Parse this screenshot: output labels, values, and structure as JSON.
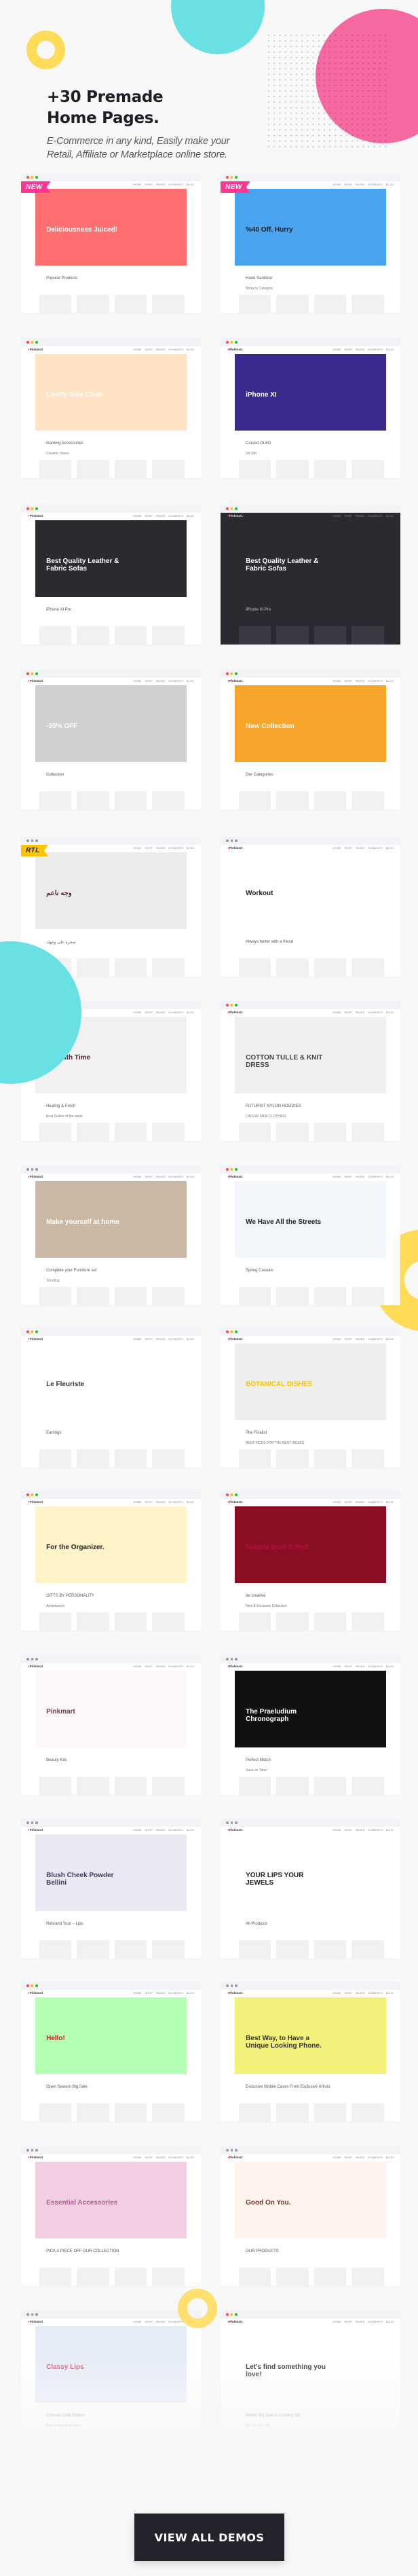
{
  "hero": {
    "title_line1": "+30 Premade",
    "title_line2": "Home Pages.",
    "subtitle_line1": "E-Commerce in any kind, Easily make your",
    "subtitle_line2": "Retail, Affiliate or Marketplace online store."
  },
  "colors": {
    "accent_pink": "#fd6ba5",
    "accent_cyan": "#69e0e4",
    "accent_yellow": "#ffdb58",
    "button_dark": "#22232b",
    "background": "#f8f8f9"
  },
  "demos": [
    {
      "ribbon": "NEW",
      "headline": "Deliciousness Juiced!",
      "sub": "Popular Products",
      "bg": "#ff6f6f",
      "fg": "#ffffff",
      "dots": "color"
    },
    {
      "ribbon": "NEW",
      "headline": "%40 Off. Hurry",
      "sub": "Hand Sanitizer",
      "extra": "Shop by Category",
      "bg": "#4aa3ef",
      "fg": "#1d1f27",
      "dots": "color"
    },
    {
      "headline": "Comfy Side Chair",
      "sub": "Gaming Accessories",
      "extra": "Ceramic Vases",
      "bg": "#ffe3c4",
      "fg": "#ffffff",
      "dots": "color"
    },
    {
      "headline": "iPhone XI",
      "sub": "Curved OLED",
      "extra": "VR Rift",
      "bg": "#3b2a8c",
      "fg": "#ffffff",
      "dots": "color"
    },
    {
      "headline": "Best Quality Leather & Fabric Sofas",
      "sub": "iPhone XI Pro",
      "bg": "#2a2b31",
      "fg": "#ffffff",
      "dots": "color"
    },
    {
      "headline": "Best Quality Leather & Fabric Sofas",
      "sub": "iPhone XI Pro",
      "bg": "#2a2b31",
      "fg": "#ffffff",
      "dots": "color",
      "dark": true
    },
    {
      "headline": "-35% OFF",
      "sub": "Collection",
      "bg": "#cfcfcf",
      "fg": "#ffffff",
      "dots": "color"
    },
    {
      "headline": "New Collection",
      "sub": "Our Categories",
      "bg": "#f7a52b",
      "fg": "#ffffff",
      "dots": "color"
    },
    {
      "ribbon": "RTL",
      "headline": "وجه ناعم",
      "sub": "صخرة على وجهك",
      "bg": "#ebebeb",
      "fg": "#5a1f2a",
      "dots": "grey"
    },
    {
      "headline": "Workout",
      "sub": "Always better with a friend",
      "bg": "#ffffff",
      "fg": "#1d1f27",
      "dots": "grey"
    },
    {
      "headline": "It's Bath Time",
      "sub": "Healing & Fresh",
      "extra": "Best Sellers of the week",
      "bg": "#f2f0f1",
      "fg": "#5a1f2a",
      "dots": "grey"
    },
    {
      "headline": "COTTON TULLE & KNIT DRESS",
      "sub": "FUTURIST NYLON HOODIES",
      "extra": "CASUAL MEN CLOTHING",
      "bg": "#efefef",
      "fg": "#444444",
      "dots": "color"
    },
    {
      "headline": "Make yourself at home",
      "sub": "Complete your Furniture set",
      "extra": "Trending",
      "bg": "#c9b8a6",
      "fg": "#ffffff",
      "dots": "grey"
    },
    {
      "headline": "We Have All the Streets",
      "sub": "Spring Casuals",
      "bg": "#f3f6fb",
      "fg": "#1d1f27",
      "dots": "none"
    },
    {
      "headline": "Le Fleuriste",
      "sub": "Earrings",
      "bg": "#ffffff",
      "fg": "#333333",
      "dots": "color"
    },
    {
      "headline": "BOTANICAL DISHES",
      "sub": "The Finalist",
      "extra": "BEST PICKS FOR THE BEST WEEKS",
      "bg": "#eeeeee",
      "fg": "#f5c400",
      "dots": "color"
    },
    {
      "headline": "For the Organizer.",
      "sub": "GIFTS BY PERSONALITY",
      "extra": "Adventurers",
      "bg": "#fff4c8",
      "fg": "#222222",
      "dots": "color"
    },
    {
      "headline": "Natural Born Gifted",
      "sub": "be creative",
      "extra": "New & Exclusive Collection",
      "bg": "#8a0f25",
      "fg": "#b0113a",
      "dots": "color"
    },
    {
      "headline": "Pinkmart",
      "sub": "Beauty Kits",
      "bg": "#fdf7f7",
      "fg": "#6b3d4a",
      "dots": "grey"
    },
    {
      "headline": "The Praeludium Chronograph",
      "sub": "Perfect Match",
      "extra": "Save on Time!",
      "bg": "#111111",
      "fg": "#ffffff",
      "dots": "grey"
    },
    {
      "headline": "Blush Cheek Powder Bellini",
      "sub": "Rebrand Your – Lips",
      "bg": "#ebe7f3",
      "fg": "#3d3a60",
      "dots": "grey"
    },
    {
      "headline": "YOUR LIPS YOUR JEWELS",
      "sub": "All Products",
      "bg": "#ffffff",
      "fg": "#1d1f27",
      "dots": "grey"
    },
    {
      "headline": "Hello!",
      "sub": "Open Season Big Sale",
      "bg": "#b5ffb5",
      "fg": "#d2121f",
      "dots": "color"
    },
    {
      "headline": "Best Way, to Have a Unique Looking Phone.",
      "sub": "Exclusive Mobile Cases From Exclusive Artists.",
      "bg": "#f2f27a",
      "fg": "#333333",
      "dots": "grey"
    },
    {
      "headline": "Essential Accessories",
      "sub": "PICK A PIECE OFF OUR COLLECTION",
      "bg": "#f3cfe3",
      "fg": "#b85a93",
      "dots": "grey"
    },
    {
      "headline": "Good On You.",
      "sub": "OUR PRODUCTS",
      "bg": "#fff3ee",
      "fg": "#7a3a2c",
      "dots": "grey"
    },
    {
      "headline": "Classy Lips",
      "sub": "Crimson Gold Edition",
      "extra": "Best Selling Right Now",
      "bg": "#e6ecf7",
      "fg": "#e85577",
      "dots": "grey"
    },
    {
      "headline": "Let's find something you love!",
      "sub": "Winter Big Sale is Coming Up!",
      "extra": "06 : 22 : 54 : 54",
      "bg": "#ffffff",
      "fg": "#333333",
      "dots": "color"
    }
  ],
  "cta": {
    "view_all_label": "VIEW ALL DEMOS"
  }
}
